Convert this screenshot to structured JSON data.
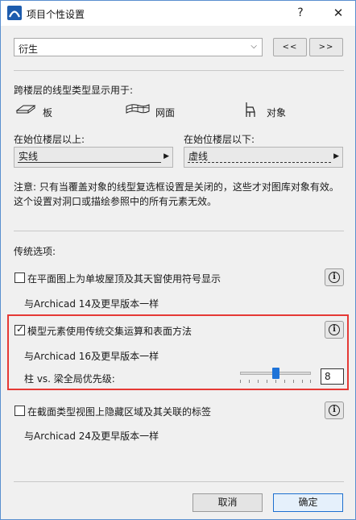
{
  "window": {
    "title": "项目个性设置",
    "help_label": "?",
    "close_label": "✕"
  },
  "preset": {
    "value": "衍生",
    "prev_label": "<<",
    "next_label": ">>"
  },
  "linetype": {
    "heading": "跨楼层的线型类型显示用于:",
    "targets": [
      {
        "label": "板",
        "icon": "slab-icon"
      },
      {
        "label": "网面",
        "icon": "mesh-icon"
      },
      {
        "label": "对象",
        "icon": "object-chair-icon"
      }
    ],
    "above": {
      "label": "在始位楼层以上:",
      "value": "实线"
    },
    "below": {
      "label": "在始位楼层以下:",
      "value": "虚线"
    },
    "note_line1": "注意: 只有当覆盖对象的线型复选框设置是关闭的，这些才对图库对象有效。",
    "note_line2": "这个设置对洞口或描绘参照中的所有元素无效。"
  },
  "legacy": {
    "heading": "传统选项:",
    "options": [
      {
        "label": "在平面图上为单坡屋顶及其天窗使用符号显示",
        "note": "与Archicad 14及更早版本一样",
        "checked": false
      },
      {
        "label": "模型元素使用传统交集运算和表面方法",
        "note": "与Archicad 16及更早版本一样",
        "checked": true
      },
      {
        "label": "在截面类型视图上隐藏区域及其关联的标签",
        "note": "与Archicad 24及更早版本一样",
        "checked": false
      }
    ],
    "priority": {
      "label": "柱 vs. 梁全局优先级:",
      "value": "8",
      "min": 0,
      "max": 16
    }
  },
  "info_label": "i",
  "buttons": {
    "cancel": "取消",
    "ok": "确定"
  },
  "colors": {
    "accent": "#1e73d8",
    "highlight": "#e53935",
    "title_icon": "#1d5cae"
  }
}
